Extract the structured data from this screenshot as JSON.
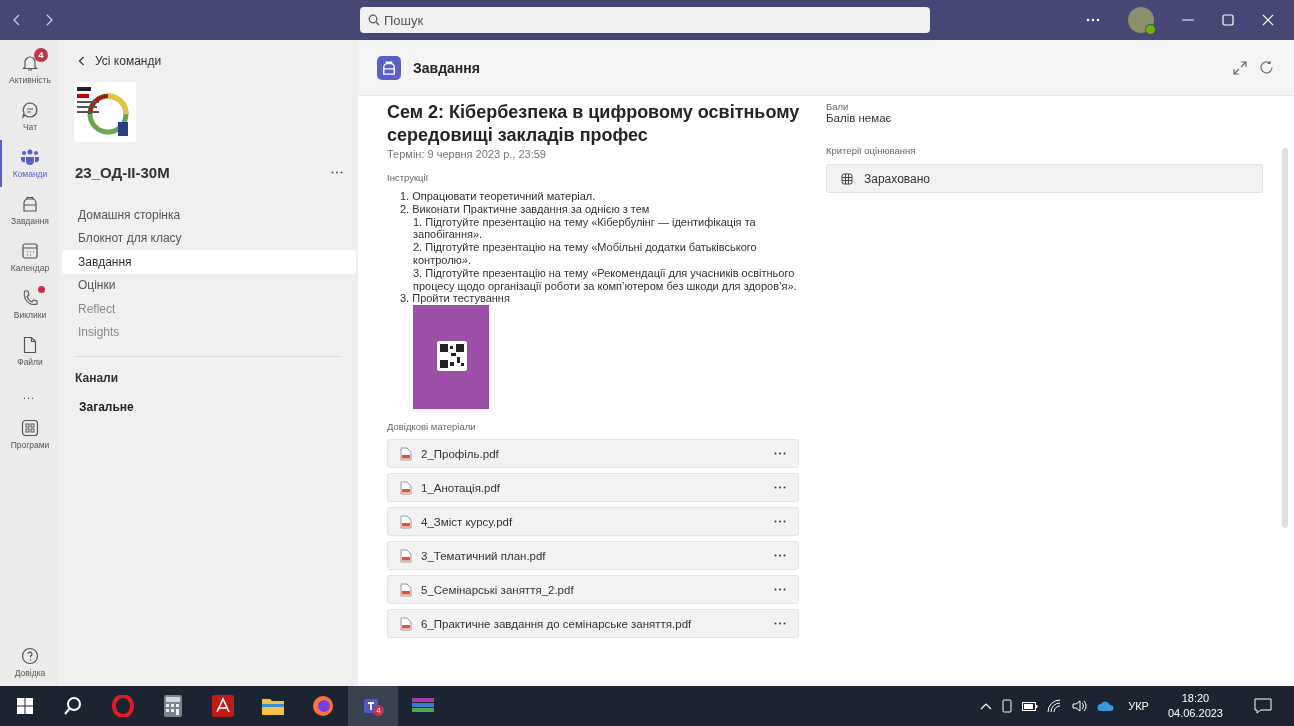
{
  "title_bar": {
    "search": {
      "placeholder": "Пошук"
    }
  },
  "rail": [
    {
      "label": "Активність",
      "badge": "4",
      "selected": false
    },
    {
      "label": "Чат",
      "selected": false
    },
    {
      "label": "Команди",
      "selected": true
    },
    {
      "label": "Завдання",
      "selected": false
    },
    {
      "label": "Календар",
      "selected": false
    },
    {
      "label": "Виклики",
      "dot": true,
      "selected": false
    },
    {
      "label": "Файли",
      "selected": false
    }
  ],
  "rail_more": "...",
  "rail_apps": {
    "label": "Програми"
  },
  "rail_help": {
    "label": "Довідка"
  },
  "team_panel": {
    "back": "Усі команди",
    "team_name": "23_ОД-ІІ-30М",
    "nav": [
      {
        "label": "Домашня сторінка",
        "selected": false
      },
      {
        "label": "Блокнот для класу",
        "selected": false
      },
      {
        "label": "Завдання",
        "selected": true
      },
      {
        "label": "Оцінки",
        "selected": false
      },
      {
        "label": "Reflect",
        "selected": false
      },
      {
        "label": "Insights",
        "selected": false
      }
    ],
    "channels_heading": "Канали",
    "channels": [
      "Загальне"
    ]
  },
  "header": {
    "title": "Завдання"
  },
  "assignment": {
    "title": "Сем 2: Кібербезпека в цифровому освітньому середовищі закладів профес",
    "due": "Термін: 9 червня 2023 р., 23:59",
    "instructions_label": "Інструкції",
    "instructions": [
      {
        "text": "1. Опрацювати теоретичний матеріал."
      },
      {
        "text": "2. Виконати Практичне завдання за однією з тем",
        "children": [
          {
            "text": "1. Підготуйте презентацію на тему «Кібербулінг — ідентифікація та запобігання»."
          },
          {
            "text": "2. Підготуйте презентацію на тему «Мобільні додатки батьківського контролю»."
          },
          {
            "text": "3. Підготуйте презентацію на тему «Рекомендації для учасників освітнього процесу щодо організації роботи за комп’ютером без шкоди для здоров’я»."
          }
        ]
      },
      {
        "text": "3. Пройти тестування"
      }
    ],
    "materials_label": "Довідкові матеріали",
    "materials": [
      "2_Профіль.pdf",
      "1_Анотація.pdf",
      "4_Зміст курсу.pdf",
      "3_Тематичний план.pdf",
      "5_Семінарські заняття_2.pdf",
      "6_Практичне завдання до семінарське заняття.pdf"
    ]
  },
  "grading": {
    "points_label": "Бали",
    "points_value": "Балів немає",
    "rubric_label": "Критерії оцінювання",
    "rubric": "Зараховано"
  },
  "taskbar": {
    "apps": [
      {
        "kind": "search",
        "selected": false
      },
      {
        "kind": "opera",
        "selected": false
      },
      {
        "kind": "calculator",
        "selected": false
      },
      {
        "kind": "pdf",
        "selected": false
      },
      {
        "kind": "folder",
        "selected": false
      },
      {
        "kind": "firefox",
        "selected": false
      },
      {
        "kind": "teams",
        "selected": true,
        "badge": "4"
      },
      {
        "kind": "archive",
        "selected": false
      }
    ],
    "language": "УКР",
    "time": "18:20",
    "date": "04.06.2023"
  }
}
